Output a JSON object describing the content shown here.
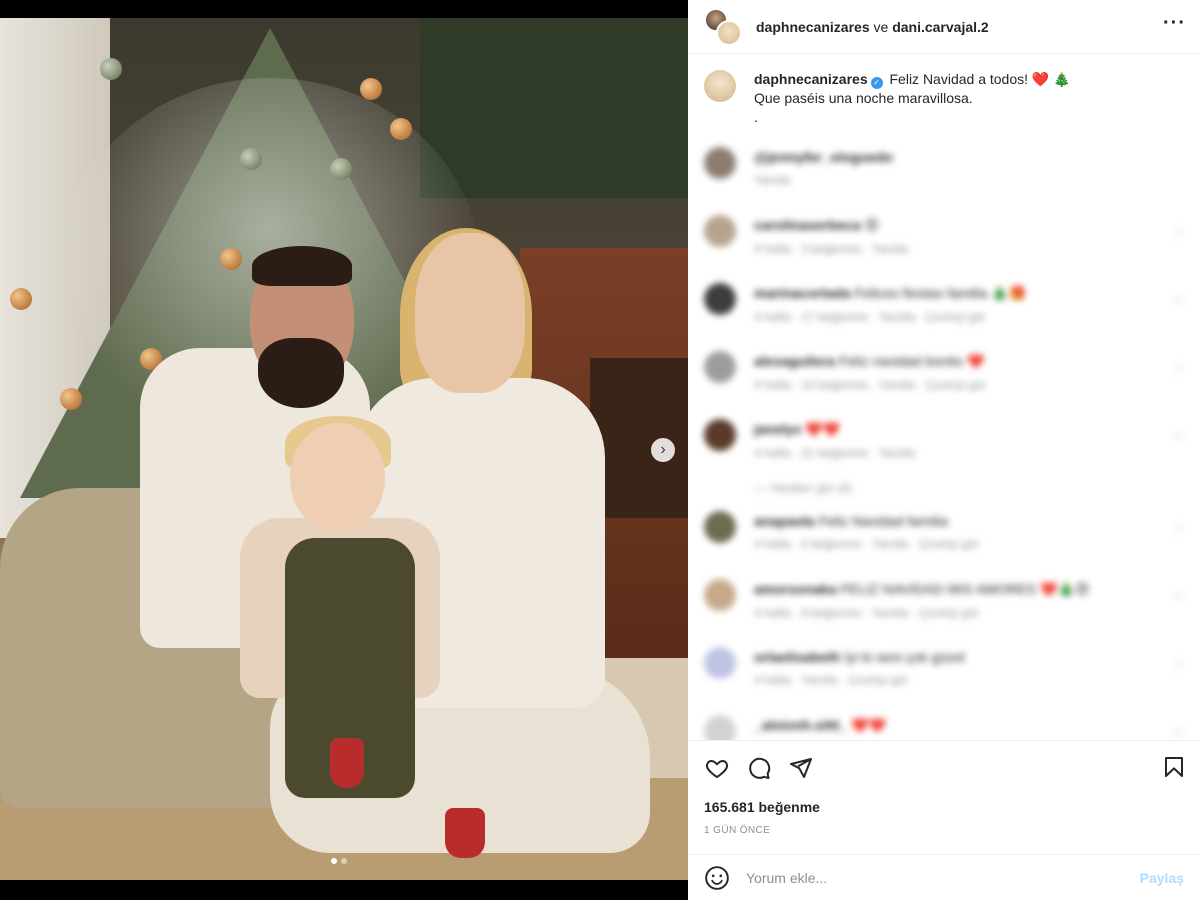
{
  "header": {
    "user1": "daphnecanizares",
    "connector": "ve",
    "user2": "dani.carvajal.2",
    "more_icon": "more-horizontal-icon"
  },
  "caption": {
    "username": "daphnecanizares",
    "line1": "Feliz Navidad a todos!",
    "line1_emoji": "❤️ 🎄",
    "line2": "Que paséis una noche maravillosa.",
    "line3": "."
  },
  "comments": [
    {
      "user": "@jennyfer_ologuedo",
      "text": "",
      "meta": "Yanıtla",
      "avatar": "#8b7e70",
      "heart": false
    },
    {
      "user": "carolinaserbeca",
      "text": "😍",
      "meta": "4 hafta · 3 beğenme · Yanıtla",
      "avatar": "#b7a48d",
      "heart": true
    },
    {
      "user": "marinacortada",
      "text": "Felices fiestas familia 🎄🎁",
      "meta": "4 hafta · 17 beğenme · Yanıtla · Çeviriyi gör",
      "avatar": "#3d3d3d",
      "heart": true
    },
    {
      "user": "alexaguilera",
      "text": "Feliz navidad bonito ❤️",
      "meta": "4 hafta · 14 beğenme · Yanıtla · Çeviriyi gör",
      "avatar": "#9d9d9d",
      "heart": true
    },
    {
      "user": "janelys",
      "text": "❤️❤️",
      "meta": "4 hafta · 21 beğenme · Yanıtla",
      "avatar": "#5a3a2a",
      "heart": true
    },
    {
      "user": "",
      "text": "— Yanıtları gör (4)",
      "meta": "",
      "avatar": "",
      "heart": false,
      "reply": true
    },
    {
      "user": "anapaola",
      "text": "Feliz Navidad familia",
      "meta": "4 hafta · 5 beğenme · Yanıtla · Çeviriyi gör",
      "avatar": "#6b6b4f",
      "heart": true
    },
    {
      "user": "amorsonaka",
      "text": "FELIZ NAVIDAD MIS AMORES ❤️🎄😍",
      "meta": "4 hafta · 9 beğenme · Yanıtla · Çeviriyi gör",
      "avatar": "#c9a989",
      "heart": true
    },
    {
      "user": "orlaelisabeth",
      "text": "İyi ki seni çok güzel",
      "meta": "4 hafta · Yanıtla · Çeviriyi gör",
      "avatar": "#c0c4e4",
      "heart": true
    },
    {
      "user": "_alsionh.sitti_",
      "text": "❤️❤️",
      "meta": "",
      "avatar": "#d2d2d2",
      "heart": true
    }
  ],
  "actions": {
    "like_icon": "heart-icon",
    "comment_icon": "comment-icon",
    "share_icon": "send-icon",
    "save_icon": "bookmark-icon",
    "likes": "165.681 beğenme",
    "time": "1 GÜN ÖNCE"
  },
  "comment_box": {
    "placeholder": "Yorum ekle...",
    "submit": "Paylaş",
    "emoji_icon": "smiley-icon"
  },
  "media": {
    "next_icon": "chevron-right-icon",
    "carousel_total": 2,
    "carousel_active": 1
  },
  "colors": {
    "verified": "#3897f0",
    "share_disabled": "#b3dbff",
    "meta_gray": "#8e8e8e"
  }
}
